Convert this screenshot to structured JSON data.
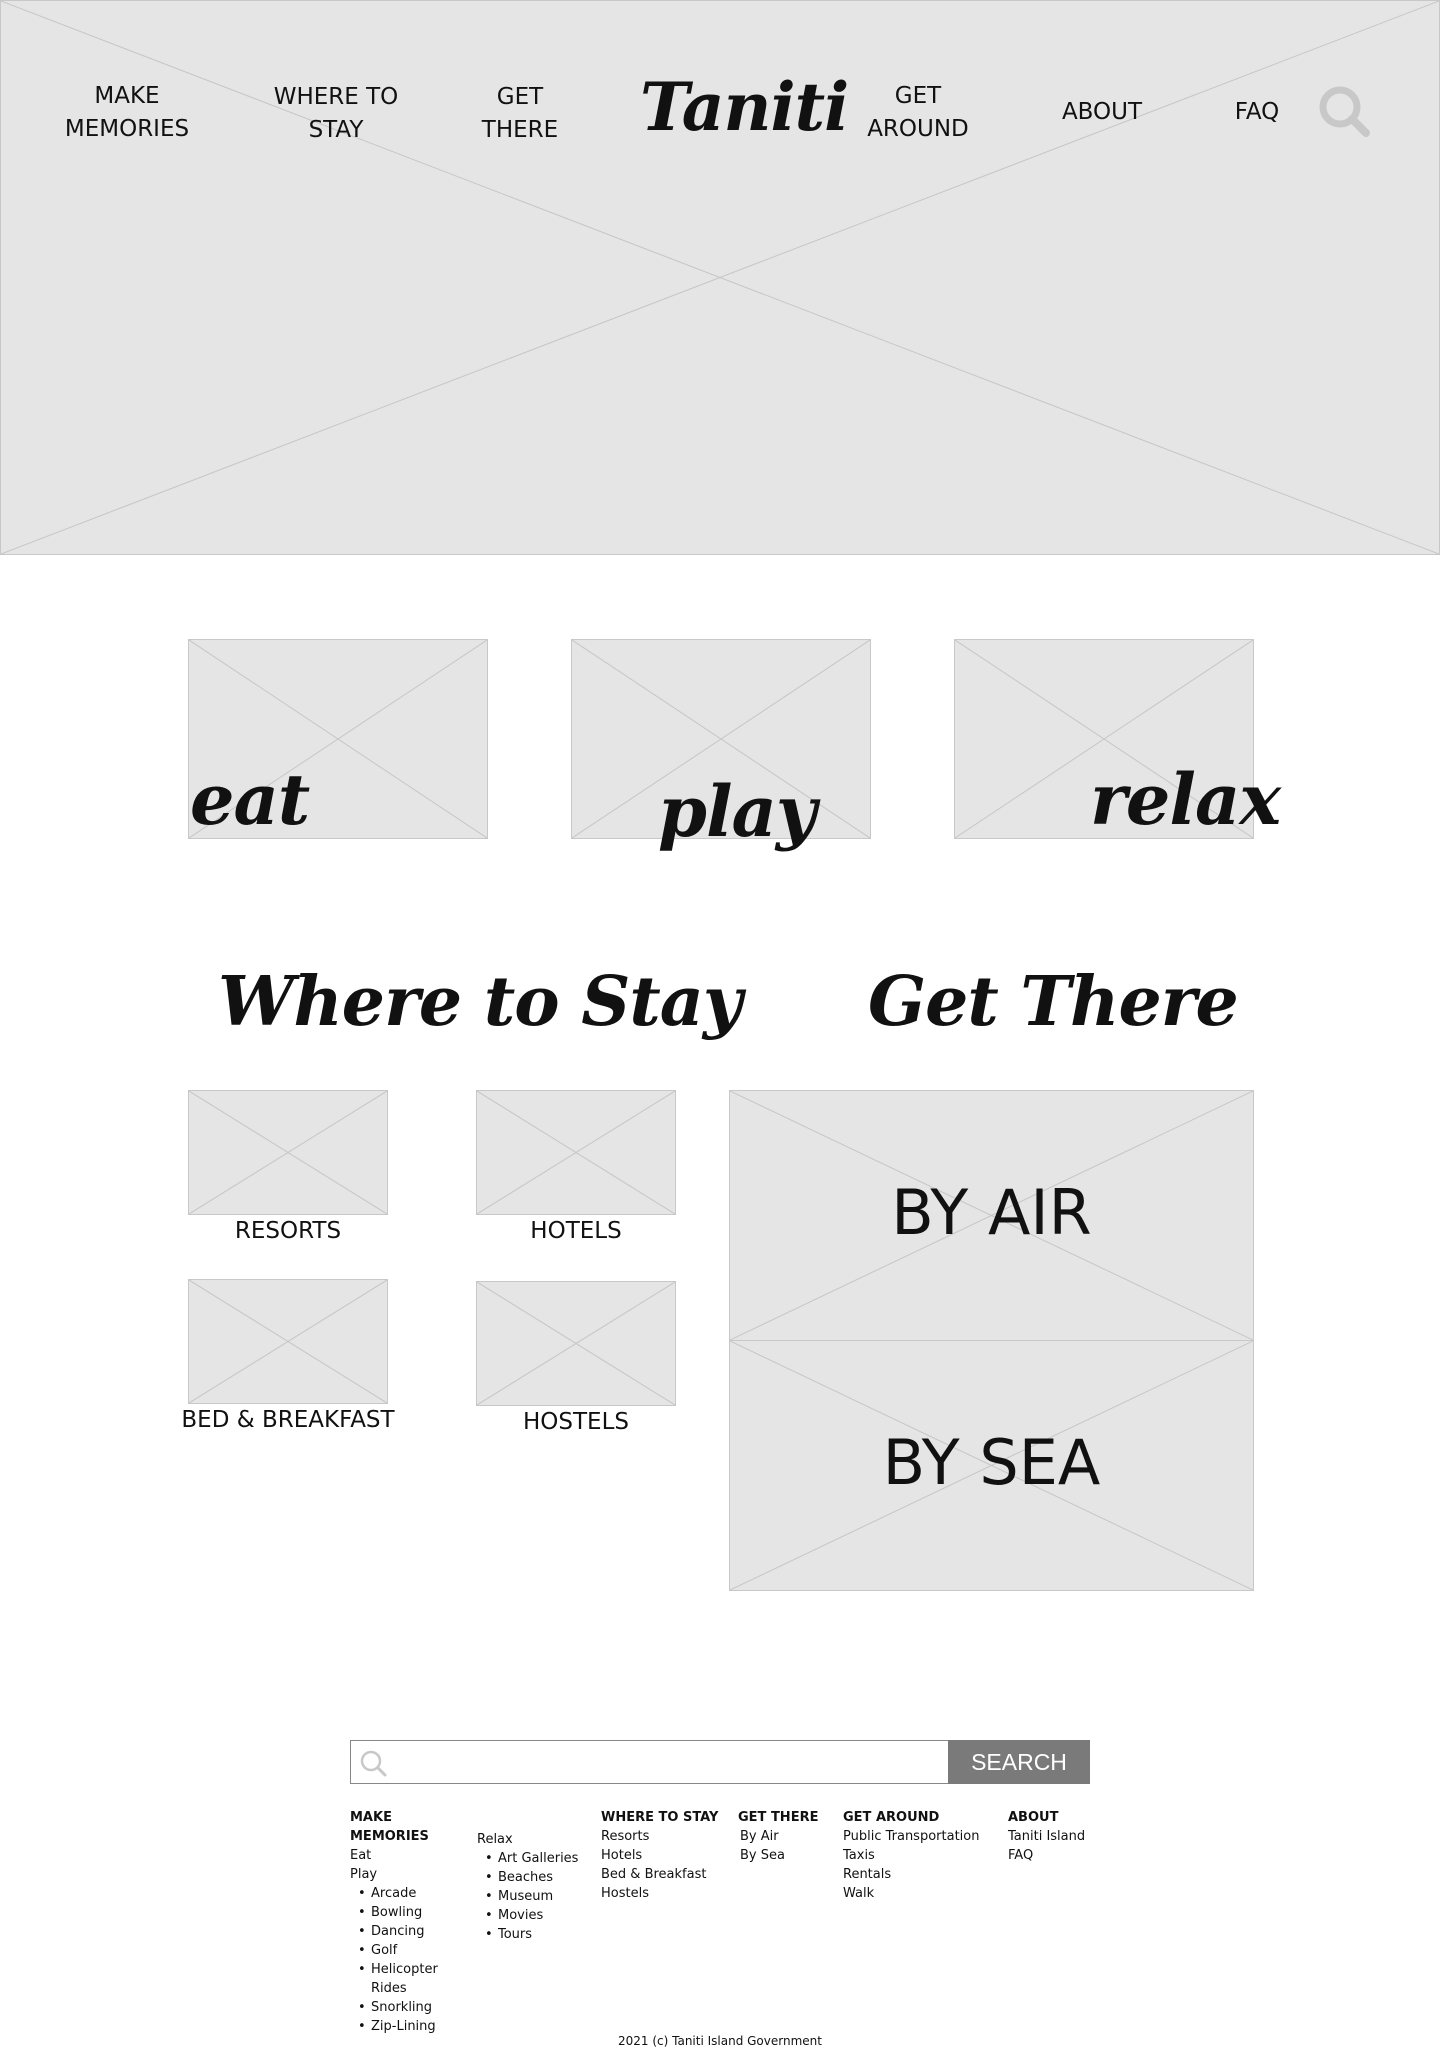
{
  "header": {
    "logo": "Taniti",
    "nav": [
      {
        "label": "MAKE\nMEMORIES"
      },
      {
        "label": "WHERE TO\nSTAY"
      },
      {
        "label": "GET\nTHERE"
      },
      {
        "label": "GET\nAROUND"
      },
      {
        "label": "ABOUT"
      },
      {
        "label": "FAQ"
      }
    ],
    "search_icon": "search-icon"
  },
  "categories": [
    {
      "label": "eat"
    },
    {
      "label": "play"
    },
    {
      "label": "relax"
    }
  ],
  "where_to_stay": {
    "title": "Where to Stay",
    "items": [
      {
        "label": "RESORTS"
      },
      {
        "label": "HOTELS"
      },
      {
        "label": "BED & BREAKFAST"
      },
      {
        "label": "HOSTELS"
      }
    ]
  },
  "get_there": {
    "title": "Get There",
    "items": [
      {
        "label": "BY AIR"
      },
      {
        "label": "BY SEA"
      }
    ]
  },
  "footer": {
    "search": {
      "placeholder": "",
      "button": "SEARCH"
    },
    "columns": {
      "make_memories": {
        "heading": "MAKE MEMORIES",
        "links": [
          "Eat",
          "Play"
        ],
        "play_items": [
          "Arcade",
          "Bowling",
          "Dancing",
          "Golf",
          "Helicopter Rides",
          "Snorkling",
          "Zip-Lining"
        ],
        "relax": "Relax",
        "relax_items": [
          "Art Galleries",
          "Beaches",
          "Museum",
          "Movies",
          "Tours"
        ]
      },
      "where_to_stay": {
        "heading": "WHERE TO STAY",
        "links": [
          "Resorts",
          "Hotels",
          "Bed & Breakfast",
          "Hostels"
        ]
      },
      "get_there": {
        "heading": "GET THERE",
        "links": [
          "By Air",
          "By Sea"
        ]
      },
      "get_around": {
        "heading": "GET AROUND",
        "links": [
          "Public Transportation",
          "Taxis",
          "Rentals",
          "Walk"
        ]
      },
      "about": {
        "heading": "ABOUT",
        "links": [
          "Taniti Island",
          "FAQ"
        ]
      }
    },
    "copyright": "2021 (c) Taniti Island Government"
  },
  "colors": {
    "placeholder": "#e5e5e5",
    "button": "#7a7a7a",
    "icon": "#c8c8c8"
  }
}
